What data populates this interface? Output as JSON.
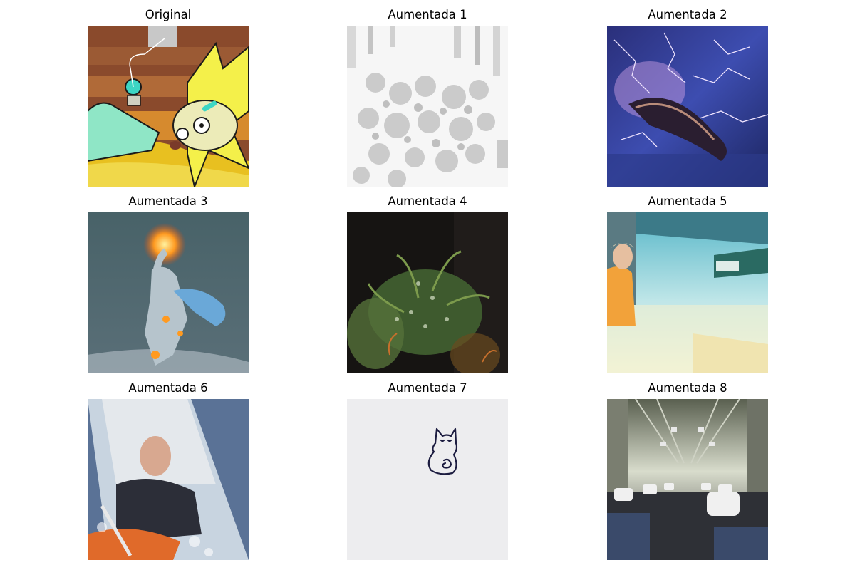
{
  "figure": {
    "panels": [
      {
        "title": "Original"
      },
      {
        "title": "Aumentada 1"
      },
      {
        "title": "Aumentada 2"
      },
      {
        "title": "Aumentada 3"
      },
      {
        "title": "Aumentada 4"
      },
      {
        "title": "Aumentada 5"
      },
      {
        "title": "Aumentada 6"
      },
      {
        "title": "Aumentada 7"
      },
      {
        "title": "Aumentada 8"
      }
    ]
  }
}
